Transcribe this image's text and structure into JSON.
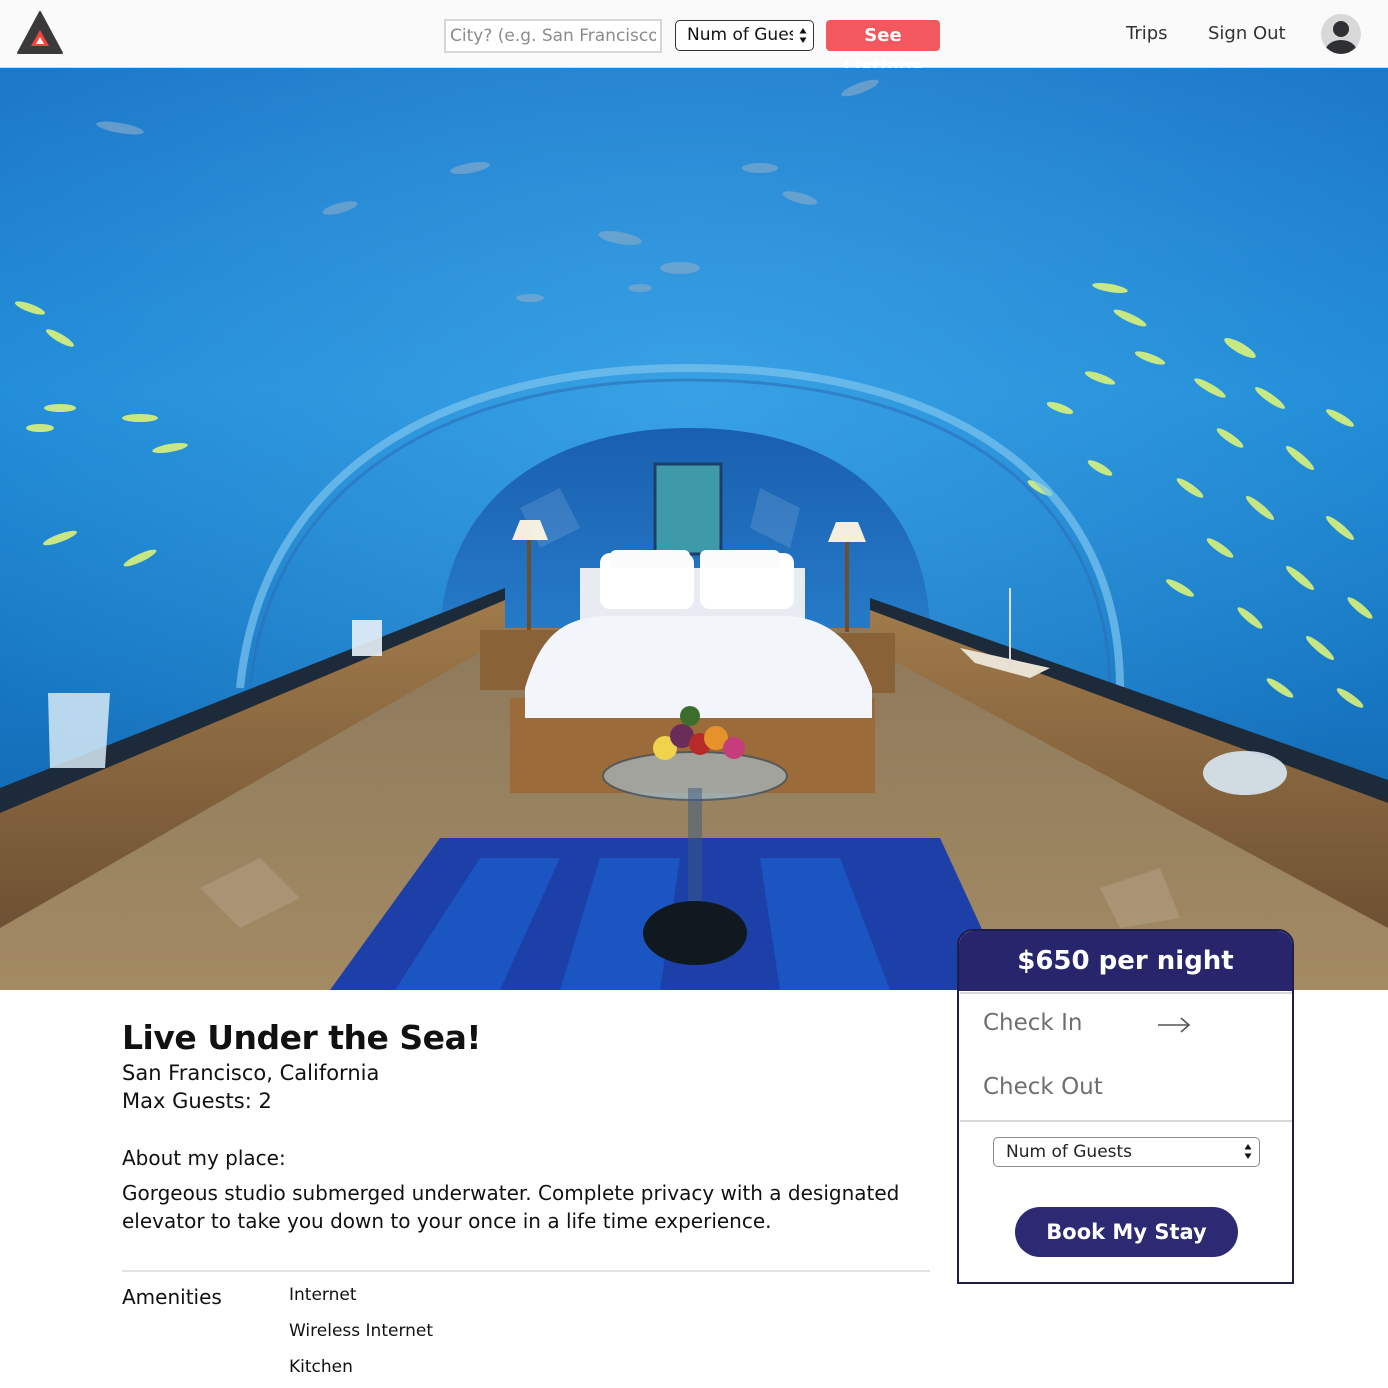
{
  "navbar": {
    "logo_icon": "airbnb-triangle-logo",
    "search_placeholder": "City? (e.g. San Francisco)",
    "guests_select_label": "Num of Guests",
    "see_listings_label": "See Listings",
    "trips_label": "Trips",
    "sign_out_label": "Sign Out",
    "avatar_icon": "user-avatar-icon"
  },
  "listing": {
    "title": "Live Under the Sea!",
    "location": "San Francisco, California",
    "max_guests": "Max Guests: 2",
    "about_label": "About my place:",
    "about_text": "Gorgeous studio submerged underwater. Complete privacy with a designated elevator to take you down to your once in a life time experience.",
    "amenities_label": "Amenities",
    "amenities": [
      "Internet",
      "Wireless Internet",
      "Kitchen"
    ]
  },
  "booking": {
    "price": "$650 per night",
    "check_in_label": "Check In",
    "check_out_label": "Check Out",
    "guests_select_label": "Num of Guests",
    "book_button_label": "Book My Stay"
  },
  "colors": {
    "accent_red": "#f2585d",
    "navy": "#27266c",
    "button_navy": "#2c2a73"
  }
}
